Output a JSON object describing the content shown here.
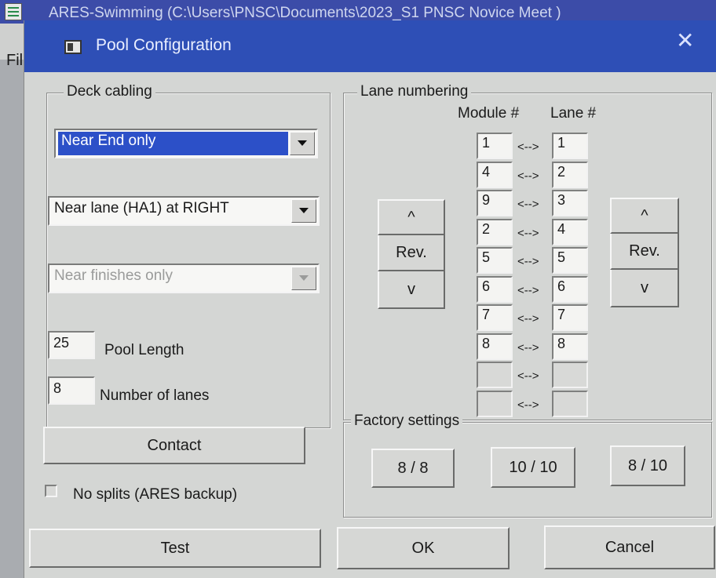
{
  "background_app": {
    "title": "ARES-Swimming (C:\\Users\\PNSC\\Documents\\2023_S1 PNSC Novice Meet )",
    "menu": {
      "file": "File"
    }
  },
  "dialog": {
    "title": "Pool Configuration",
    "close_icon": "close-icon"
  },
  "deck_cabling": {
    "group_label": "Deck cabling",
    "cabling_select": {
      "value": "Near End only",
      "selected": true
    },
    "lane_side_select": {
      "value": "Near lane (HA1) at RIGHT"
    },
    "finishes_select": {
      "value": "Near finishes only",
      "disabled": true
    },
    "pool_length": {
      "value": "25",
      "label": "Pool Length"
    },
    "number_of_lanes": {
      "value": "8",
      "label": "Number of lanes"
    },
    "contact_button": "Contact",
    "no_splits": {
      "label": "No splits (ARES backup)",
      "checked": false
    }
  },
  "lane_numbering": {
    "group_label": "Lane numbering",
    "module_header": "Module #",
    "lane_header": "Lane #",
    "separator": "<-->",
    "rows": [
      {
        "module": "1",
        "lane": "1"
      },
      {
        "module": "4",
        "lane": "2"
      },
      {
        "module": "9",
        "lane": "3"
      },
      {
        "module": "2",
        "lane": "4"
      },
      {
        "module": "5",
        "lane": "5"
      },
      {
        "module": "6",
        "lane": "6"
      },
      {
        "module": "7",
        "lane": "7"
      },
      {
        "module": "8",
        "lane": "8"
      },
      {
        "module": "",
        "lane": ""
      },
      {
        "module": "",
        "lane": ""
      }
    ],
    "left_controls": {
      "up": "^",
      "rev": "Rev.",
      "down": "v"
    },
    "right_controls": {
      "up": "^",
      "rev": "Rev.",
      "down": "v"
    }
  },
  "factory_settings": {
    "group_label": "Factory settings",
    "buttons": [
      "8 / 8",
      "10 / 10",
      "8 / 10"
    ]
  },
  "footer": {
    "test": "Test",
    "ok": "OK",
    "cancel": "Cancel"
  },
  "colors": {
    "titlebar": "#2e4fb6",
    "selection": "#2c50c8",
    "face": "#d4d6d4"
  }
}
